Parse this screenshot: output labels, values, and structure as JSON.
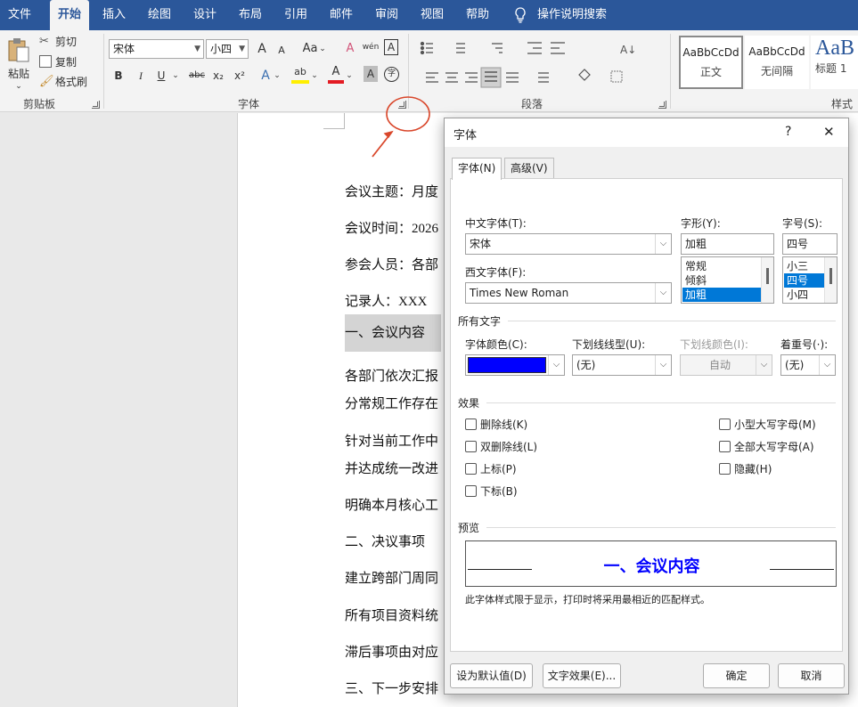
{
  "menu": {
    "tabs": [
      "文件",
      "开始",
      "插入",
      "绘图",
      "设计",
      "布局",
      "引用",
      "邮件",
      "审阅",
      "视图",
      "帮助"
    ],
    "active_index": 1,
    "search_label": "操作说明搜索"
  },
  "ribbon": {
    "clipboard": {
      "paste": "粘贴",
      "cut": "剪切",
      "copy": "复制",
      "format_painter": "格式刷",
      "label": "剪贴板"
    },
    "font": {
      "family": "宋体",
      "size": "小四",
      "label": "字体",
      "bold": "B",
      "italic": "I",
      "underline": "U",
      "strike": "abc",
      "subscript": "x₂",
      "superscript": "x²",
      "case": "Aa",
      "grow": "A",
      "shrink": "A",
      "clear": "A",
      "phonetic": "wén",
      "border": "A",
      "effects": "A",
      "highlight": "ab",
      "color": "A",
      "shade": "A",
      "enclose": "字"
    },
    "paragraph": {
      "label": "段落"
    },
    "styles": {
      "label": "样式",
      "items": [
        {
          "sample": "AaBbCcDd",
          "name": "正文"
        },
        {
          "sample": "AaBbCcDd",
          "name": "无间隔"
        },
        {
          "sample": "AaB",
          "name": "标题 1"
        }
      ]
    }
  },
  "document": {
    "lines": [
      "会议主题：月度",
      "会议时间：2026",
      "参会人员：各部",
      "记录人：XXX",
      "一、会议内容",
      "各部门依次汇报",
      "分常规工作存在",
      "针对当前工作中",
      "并达成统一改进",
      "明确本月核心工",
      "二、决议事项",
      "建立跨部门周同",
      "所有项目资料统",
      "滞后事项由对应",
      "三、下一步安排"
    ],
    "highlighted_index": 4
  },
  "dialog": {
    "title": "字体",
    "help": "?",
    "close": "✕",
    "tabs": [
      "字体(N)",
      "高级(V)"
    ],
    "labels": {
      "cn_font": "中文字体(T):",
      "style": "字形(Y):",
      "size": "字号(S):",
      "west_font": "西文字体(F):",
      "all_text": "所有文字",
      "font_color": "字体颜色(C):",
      "underline_type": "下划线线型(U):",
      "underline_color": "下划线颜色(I):",
      "emphasis": "着重号(·):",
      "effects": "效果",
      "preview": "预览"
    },
    "values": {
      "cn_font": "宋体",
      "style": "加粗",
      "size": "四号",
      "west_font": "Times New Roman",
      "underline_type": "(无)",
      "underline_color": "自动",
      "emphasis": "(无)"
    },
    "style_list": [
      "常规",
      "倾斜",
      "加粗"
    ],
    "style_selected": 2,
    "size_list": [
      "小三",
      "四号",
      "小四"
    ],
    "size_selected": 1,
    "font_color_hex": "#0000ff",
    "effects_left": [
      "删除线(K)",
      "双删除线(L)",
      "上标(P)",
      "下标(B)"
    ],
    "effects_right": [
      "小型大写字母(M)",
      "全部大写字母(A)",
      "隐藏(H)"
    ],
    "preview_text": "一、会议内容",
    "preview_note": "此字体样式限于显示，打印时将采用最相近的匹配样式。",
    "buttons": {
      "set_default": "设为默认值(D)",
      "text_effects": "文字效果(E)...",
      "ok": "确定",
      "cancel": "取消"
    }
  },
  "colors": {
    "ribbon_blue": "#2b579a",
    "selection": "#0078d7",
    "annotation": "#d9472b"
  }
}
